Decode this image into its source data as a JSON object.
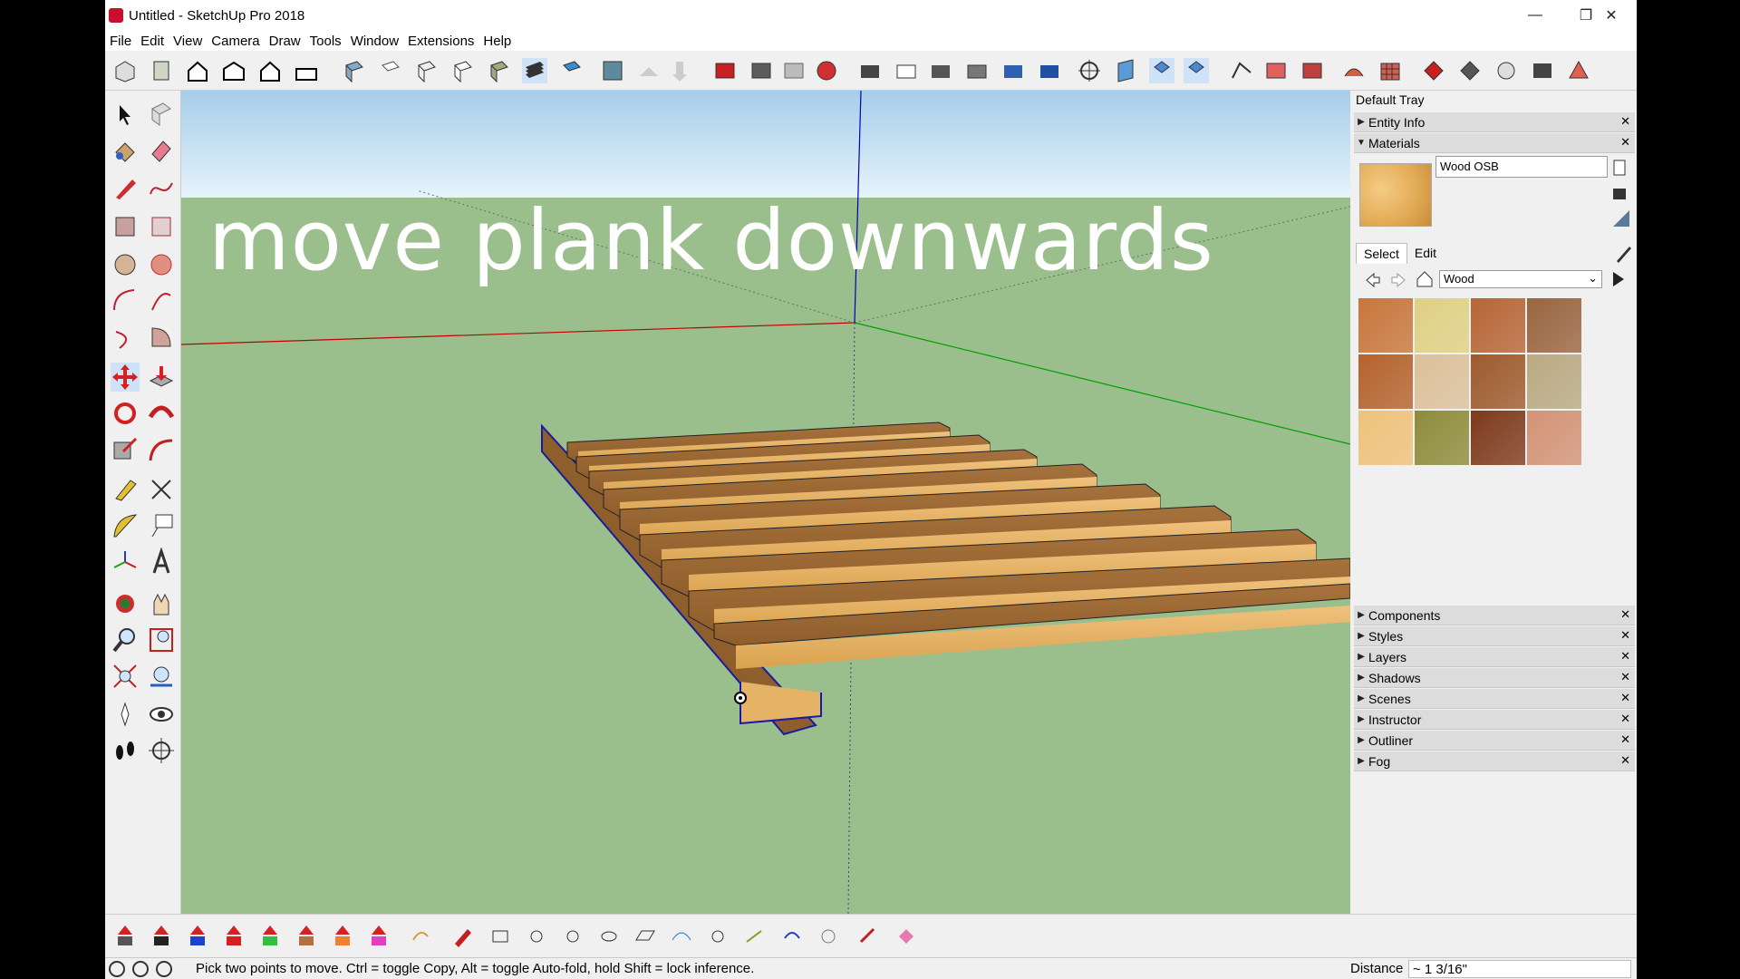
{
  "window": {
    "title": "Untitled - SketchUp Pro 2018",
    "minimize": "—",
    "restore": "❐",
    "close": "✕"
  },
  "menu": [
    "File",
    "Edit",
    "View",
    "Camera",
    "Draw",
    "Tools",
    "Window",
    "Extensions",
    "Help"
  ],
  "overlay_text": "move plank downwards",
  "tray": {
    "title": "Default Tray",
    "panels_top": [
      "Entity Info",
      "Materials"
    ],
    "material_name": "Wood OSB",
    "tabs": [
      "Select",
      "Edit"
    ],
    "library": "Wood",
    "panels_bottom": [
      "Components",
      "Styles",
      "Layers",
      "Shadows",
      "Scenes",
      "Instructor",
      "Outliner",
      "Fog"
    ],
    "swatch_colors": [
      "#c8763a",
      "#e0d084",
      "#b86536",
      "#9a6540",
      "#b5622c",
      "#dbc19a",
      "#9e5a2c",
      "#b9aa82",
      "#efc27a",
      "#8e8c3a",
      "#7e3a1c",
      "#d39376"
    ]
  },
  "status": {
    "message": "Pick two points to move.  Ctrl = toggle Copy, Alt = toggle Auto-fold, hold Shift = lock inference.",
    "distance_label": "Distance",
    "distance_value": "~ 1 3/16\""
  },
  "colors": {
    "ground": "#9abf8d",
    "sky": "#bfe0f2",
    "red_axis": "#c00000",
    "green_axis": "#00a000",
    "blue_axis": "#0000c0",
    "wood": "#d9a24e"
  }
}
